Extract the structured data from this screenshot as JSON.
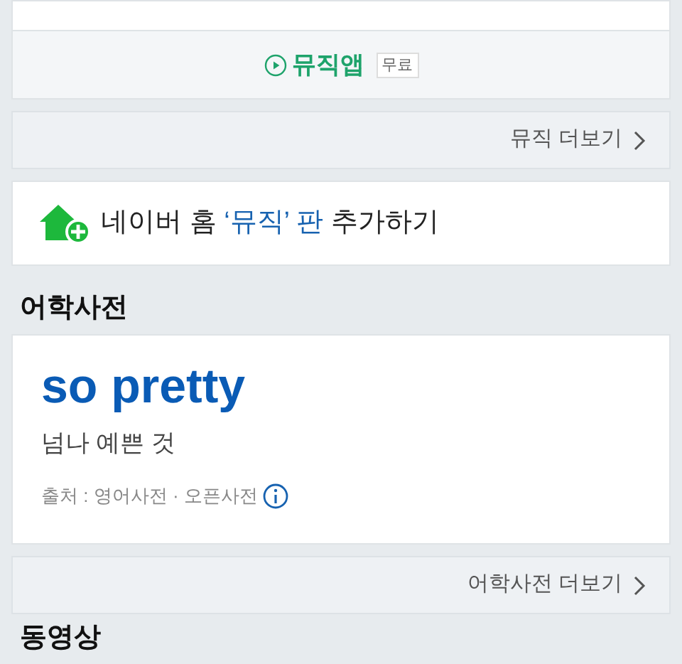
{
  "music_card": {
    "app_link": "뮤직앱",
    "app_badge": "무료"
  },
  "music_more": {
    "label": "뮤직 더보기"
  },
  "home_add": {
    "parts": [
      {
        "text": "네이버 홈 ",
        "highlight": false
      },
      {
        "text": "‘뮤직’ 판",
        "highlight": true
      },
      {
        "text": " 추가하기",
        "highlight": false
      }
    ]
  },
  "dictionary": {
    "heading": "어학사전",
    "word": "so pretty",
    "meaning": "넘나 예쁜 것",
    "source": "출처 : 영어사전 · 오픈사전"
  },
  "dictionary_more": {
    "label": "어학사전 더보기"
  },
  "next_section": {
    "heading": "동영상"
  }
}
